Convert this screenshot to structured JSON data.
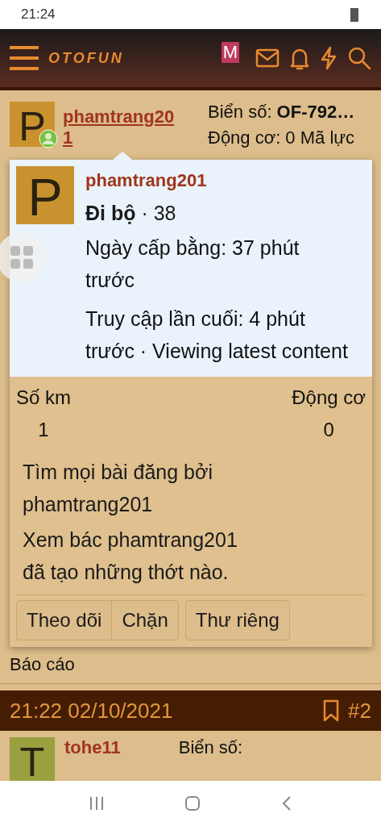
{
  "status_bar": {
    "time": "21:24"
  },
  "header": {
    "logo": "OTOFUN",
    "badge": "M"
  },
  "post": {
    "avatar_letter": "P",
    "username": "phamtrang201",
    "plate": "Biển số: **OF-792…**",
    "engine": "Động cơ: 0 Mã lực",
    "report": "Báo cáo"
  },
  "popup": {
    "avatar_letter": "P",
    "username": "phamtrang201",
    "rank": "**Đi bộ** · 38",
    "joined": "Ngày cấp bằng: 37 phút trước",
    "last_seen": "Truy cập lần cuối: 4 phút trước · Viewing latest content",
    "stats": [
      {
        "label": "Số km",
        "value": "1"
      },
      {
        "label": "Động cơ",
        "value": "0"
      }
    ],
    "links": [
      "Tìm mọi bài đăng bởi phamtrang201",
      "Xem bác phamtrang201 đã tạo những thớt nào."
    ],
    "buttons": [
      "Theo dõi",
      "Chặn",
      "Thư riêng"
    ]
  },
  "date_bar": {
    "datetime": "21:22 02/10/2021",
    "number": "#2"
  },
  "next_post": {
    "avatar_letter": "T",
    "username": "tohe11",
    "plate": "Biển số:"
  }
}
